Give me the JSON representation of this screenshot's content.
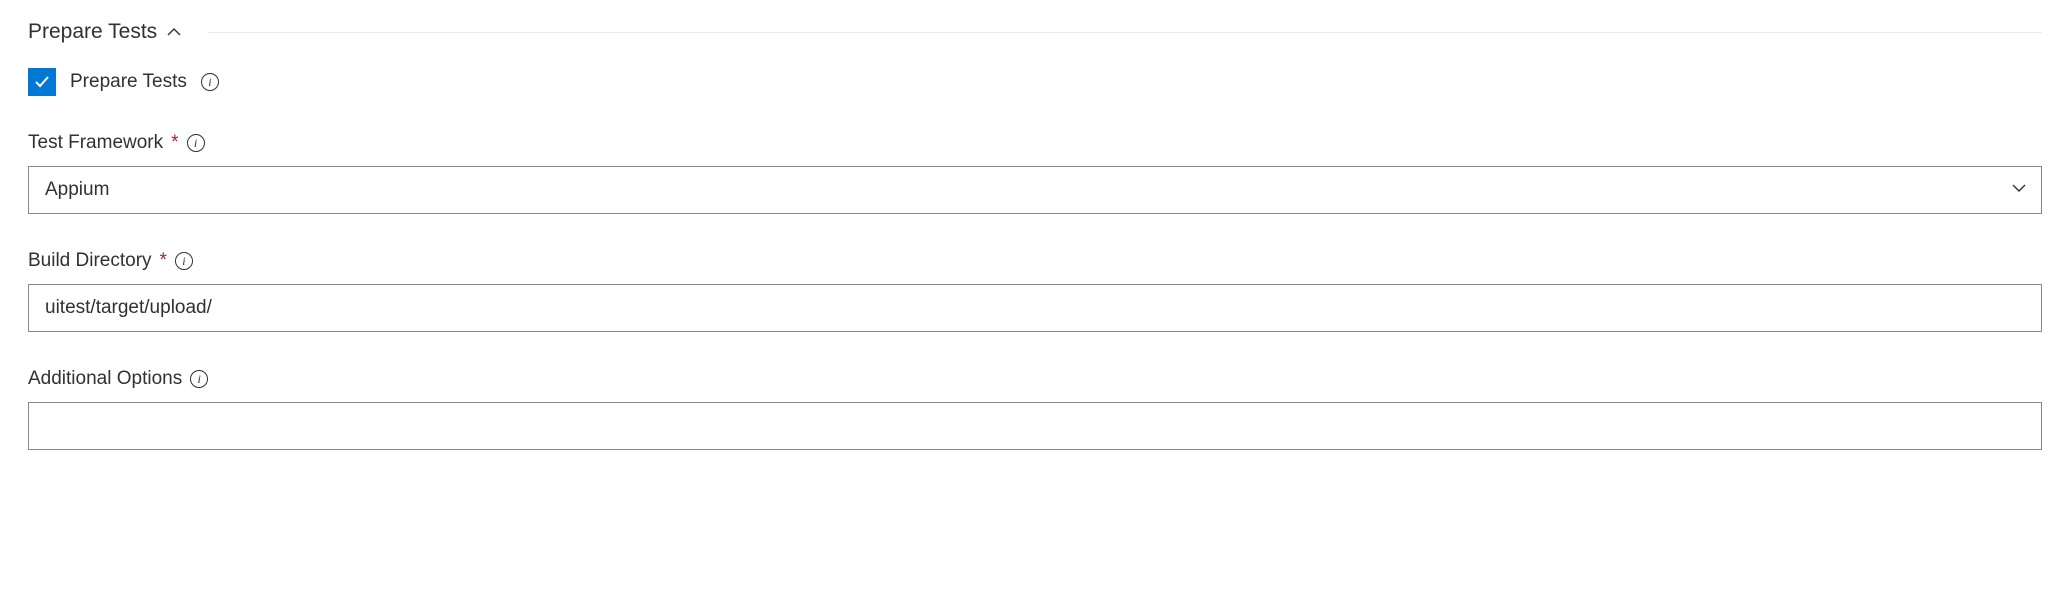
{
  "section": {
    "title": "Prepare Tests"
  },
  "checkbox": {
    "checked": true,
    "label": "Prepare Tests"
  },
  "fields": {
    "framework": {
      "label": "Test Framework",
      "required": true,
      "value": "Appium"
    },
    "buildDirectory": {
      "label": "Build Directory",
      "required": true,
      "value": "uitest/target/upload/"
    },
    "additionalOptions": {
      "label": "Additional Options",
      "required": false,
      "value": ""
    }
  }
}
